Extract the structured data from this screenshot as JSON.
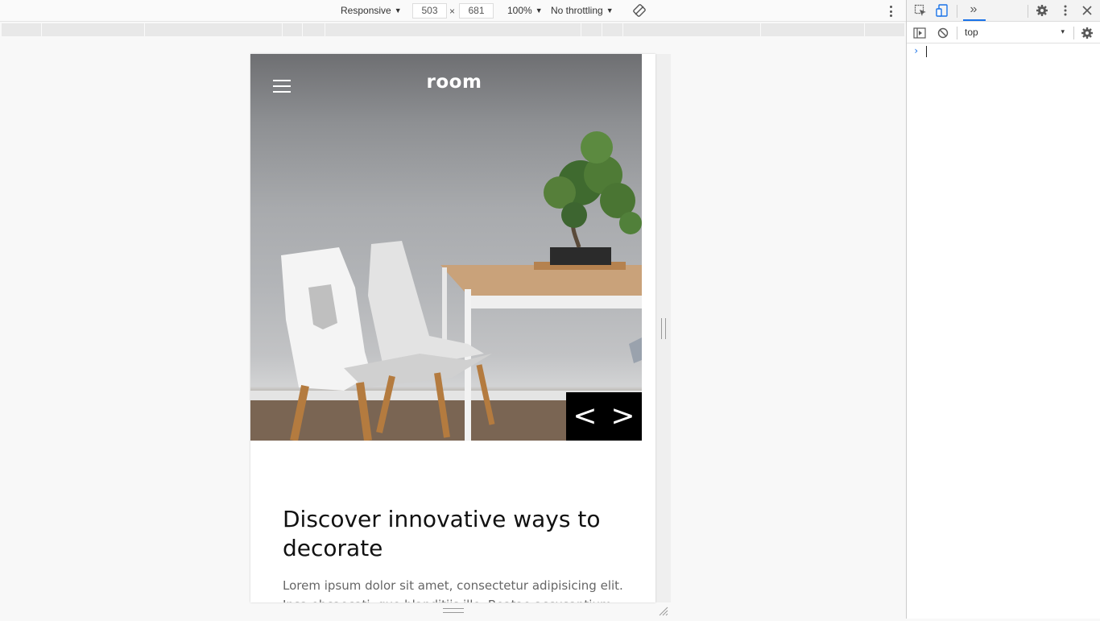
{
  "device_toolbar": {
    "device_mode": "Responsive",
    "width": "503",
    "height": "681",
    "times": "×",
    "zoom": "100%",
    "throttling": "No throttling",
    "caret": "▼"
  },
  "page": {
    "brand": "room",
    "slider_prev": "<",
    "slider_next": ">",
    "headline": "Discover innovative ways to decorate",
    "body": "Lorem ipsum dolor sit amet, consectetur adipisicing elit. Ipsa obcaecati, quo blanditiis illo. Beatae accusantium"
  },
  "devtools": {
    "more_tabs": "»",
    "context": "top",
    "context_caret": "▾",
    "prompt": "›"
  },
  "colors": {
    "devtools_accent": "#1a73e8",
    "slider_bg": "#000000",
    "headline": "#111111",
    "body_text": "#666666"
  }
}
